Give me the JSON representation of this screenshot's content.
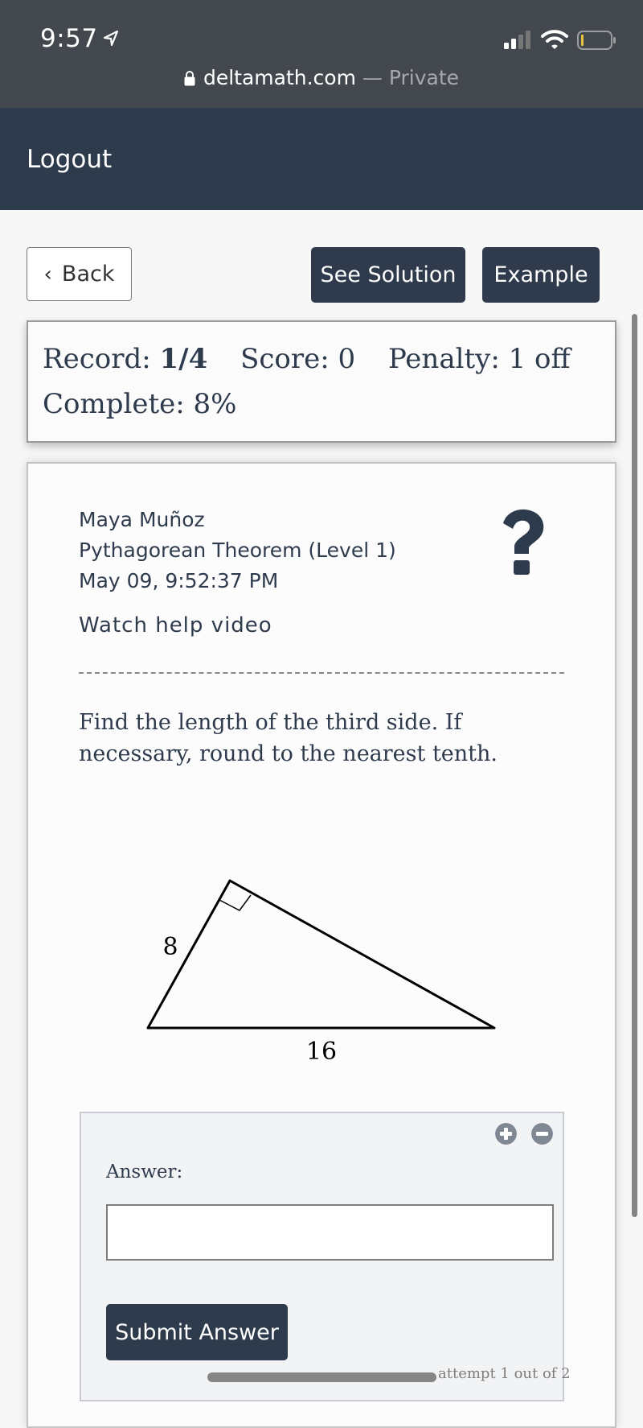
{
  "status_bar": {
    "time": "9:57",
    "location_icon": "location-arrow-icon",
    "signal_icon": "cellular-signal-icon",
    "wifi_icon": "wifi-icon",
    "battery_icon": "battery-low-icon"
  },
  "address_bar": {
    "lock_icon": "lock-icon",
    "domain": "deltamath.com",
    "separator": " — ",
    "mode": "Private"
  },
  "navbar": {
    "logout_label": "Logout"
  },
  "toolbar": {
    "back_label": "Back",
    "see_solution_label": "See Solution",
    "example_label": "Example"
  },
  "record": {
    "record_label": "Record: ",
    "record_value": "1/4",
    "score_label": "Score: 0",
    "penalty_label": "Penalty: 1 off",
    "complete_label": "Complete: 8%"
  },
  "problem": {
    "student_name": "Maya Muñoz",
    "topic": "Pythagorean Theorem (Level 1)",
    "timestamp": "May 09, 9:52:37 PM",
    "help_link": "Watch help video",
    "help_icon": "question-mark-icon",
    "question_text": "Find the length of the third side. If necessary, round to the nearest tenth.",
    "figure": {
      "type": "right-triangle",
      "leg_label": "8",
      "hypotenuse_label": "16"
    }
  },
  "answer": {
    "label": "Answer:",
    "value": "",
    "placeholder": "",
    "zoom_in_icon": "plus-circle-icon",
    "zoom_out_icon": "minus-circle-icon",
    "submit_label": "Submit Answer",
    "attempt_text": "attempt 1 out of 2"
  },
  "colors": {
    "brand_dark": "#2e3b4d",
    "status_bar": "#43484f"
  }
}
